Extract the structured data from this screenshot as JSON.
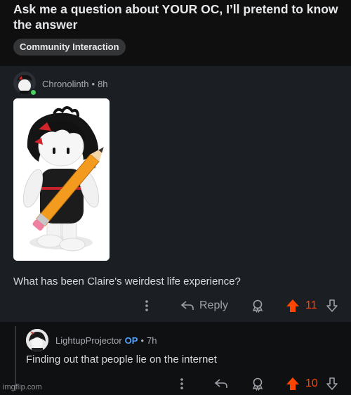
{
  "post": {
    "title": "Ask me a question about YOUR OC, I’ll pretend to know the answer",
    "flair": "Community Interaction"
  },
  "comment1": {
    "username": "Chronolinth",
    "time": "8h",
    "body": "What has been Claire's weirdest life experience?",
    "reply_label": "Reply",
    "votes": "11",
    "image_description": "3D render of a character with messy black hair and red bow holding a giant pencil"
  },
  "comment2": {
    "username": "LightupProjector",
    "op_badge": "OP",
    "time": "7h",
    "body": "Finding out that people lie on the internet",
    "votes": "10"
  },
  "watermark": "imgflip.com",
  "colors": {
    "upvote": "#ff4500",
    "op": "#4fa3ff",
    "online": "#46d160"
  },
  "icons": [
    "more-vertical-icon",
    "reply-icon",
    "award-icon",
    "upvote-icon",
    "downvote-icon"
  ]
}
